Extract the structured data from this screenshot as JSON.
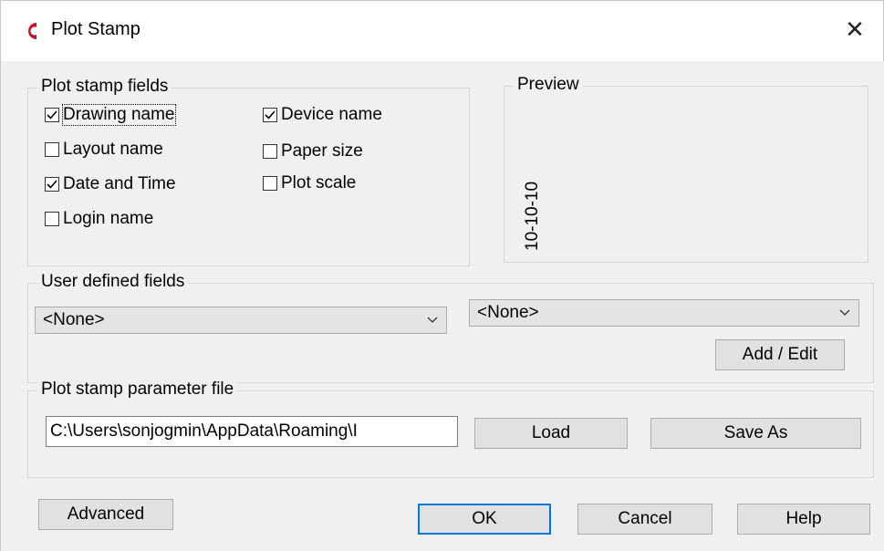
{
  "window": {
    "title": "Plot Stamp",
    "close_icon": "close-icon",
    "accent_color": "#0078d7",
    "logo_color": "#c8102e"
  },
  "plot_stamp_fields": {
    "label": "Plot stamp fields",
    "items": [
      {
        "label": "Drawing name",
        "checked": true
      },
      {
        "label": "Layout name",
        "checked": false
      },
      {
        "label": "Date and Time",
        "checked": true
      },
      {
        "label": "Login name",
        "checked": false
      },
      {
        "label": "Device name",
        "checked": true
      },
      {
        "label": "Paper size",
        "checked": false
      },
      {
        "label": "Plot scale",
        "checked": false
      }
    ]
  },
  "preview": {
    "label": "Preview",
    "sample": "10-10-10"
  },
  "user_defined": {
    "label": "User defined fields",
    "combo1": "<None>",
    "combo2": "<None>",
    "add_edit": "Add / Edit"
  },
  "param_file": {
    "label": "Plot stamp parameter file",
    "path": "C:\\Users\\sonjogmin\\AppData\\Roaming\\I",
    "load": "Load",
    "save_as": "Save As"
  },
  "footer": {
    "advanced": "Advanced",
    "ok": "OK",
    "cancel": "Cancel",
    "help": "Help"
  }
}
